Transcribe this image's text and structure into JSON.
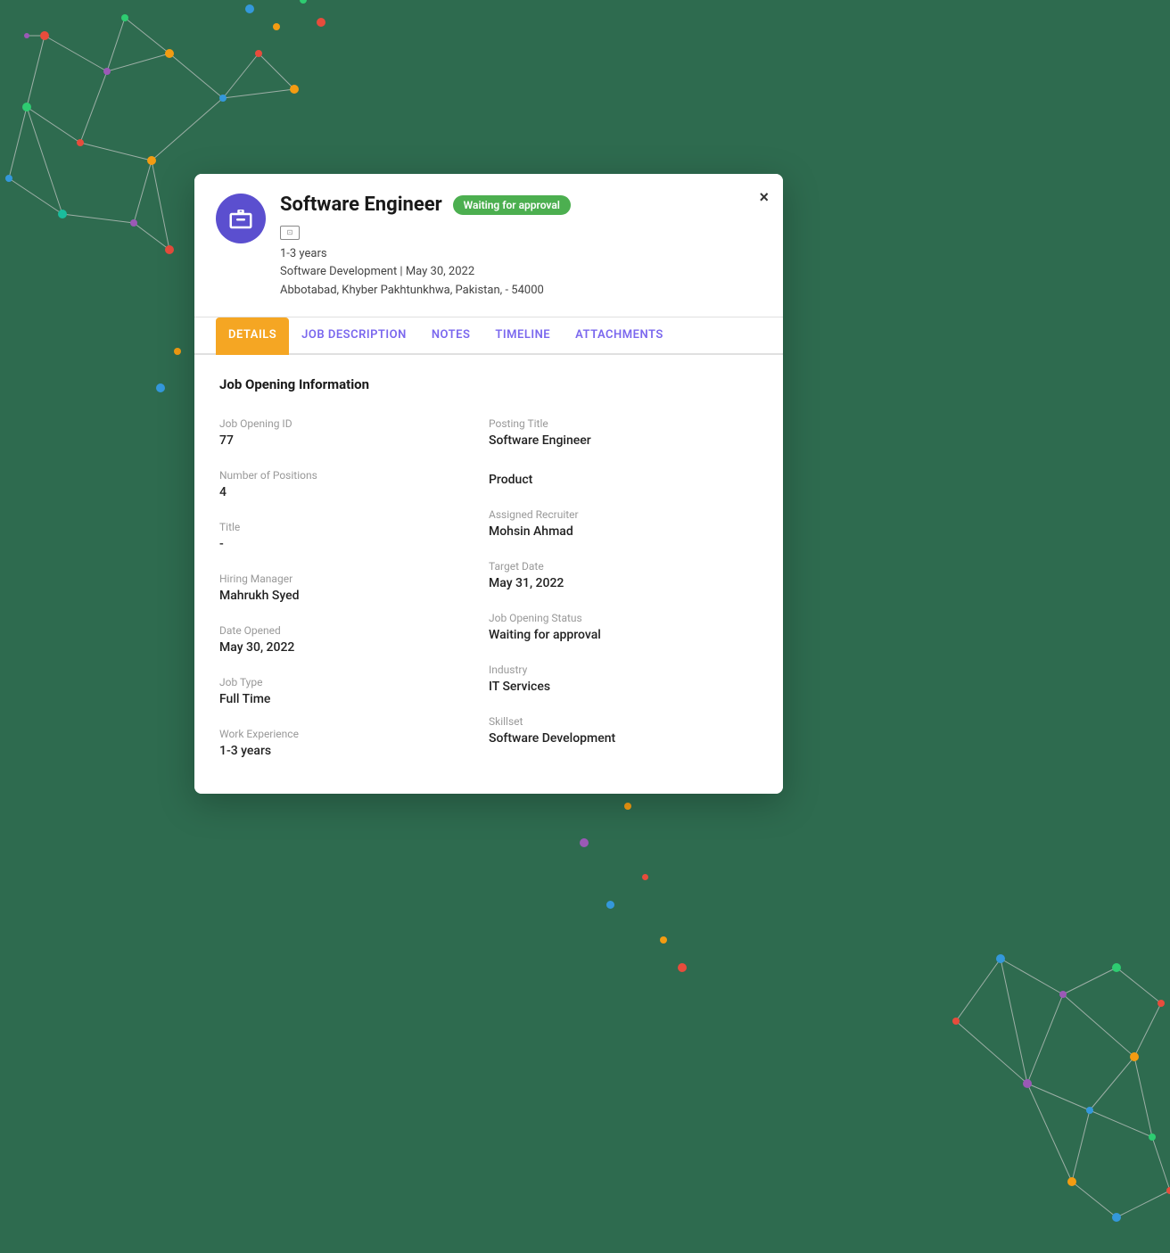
{
  "background_color": "#2e6b4f",
  "modal": {
    "header": {
      "job_title": "Software Engineer",
      "status_badge": "Waiting for approval",
      "experience": "1-3 years",
      "department_date": "Software Development | May 30, 2022",
      "location": "Abbotabad, Khyber Pakhtunkhwa, Pakistan, - 54000",
      "close_label": "×"
    },
    "tabs": [
      {
        "label": "DETAILS",
        "active": true
      },
      {
        "label": "JOB DESCRIPTION",
        "active": false
      },
      {
        "label": "NOTES",
        "active": false
      },
      {
        "label": "TIMELINE",
        "active": false
      },
      {
        "label": "ATTACHMENTS",
        "active": false
      }
    ],
    "content": {
      "section_title": "Job Opening Information",
      "left_fields": [
        {
          "label": "Job Opening ID",
          "value": "77"
        },
        {
          "label": "Number of Positions",
          "value": "4"
        },
        {
          "label": "Title",
          "value": "-"
        },
        {
          "label": "Hiring Manager",
          "value": "Mahrukh Syed"
        },
        {
          "label": "Date Opened",
          "value": "May 30, 2022"
        },
        {
          "label": "Job Type",
          "value": "Full Time"
        },
        {
          "label": "Work Experience",
          "value": "1-3 years"
        }
      ],
      "right_fields": [
        {
          "label": "Posting Title",
          "value": "Software Engineer"
        },
        {
          "label": "",
          "value": "Product"
        },
        {
          "label": "Assigned Recruiter",
          "value": "Mohsin Ahmad"
        },
        {
          "label": "Target Date",
          "value": "May 31, 2022"
        },
        {
          "label": "Job Opening Status",
          "value": "Waiting for approval"
        },
        {
          "label": "Industry",
          "value": "IT Services"
        },
        {
          "label": "Skillset",
          "value": "Software Development"
        }
      ]
    }
  },
  "colors": {
    "accent_purple": "#5b4fcf",
    "accent_green": "#4caf50",
    "accent_orange": "#f5a623",
    "tab_active_bg": "#f5a623",
    "tab_link": "#7b68ee"
  }
}
